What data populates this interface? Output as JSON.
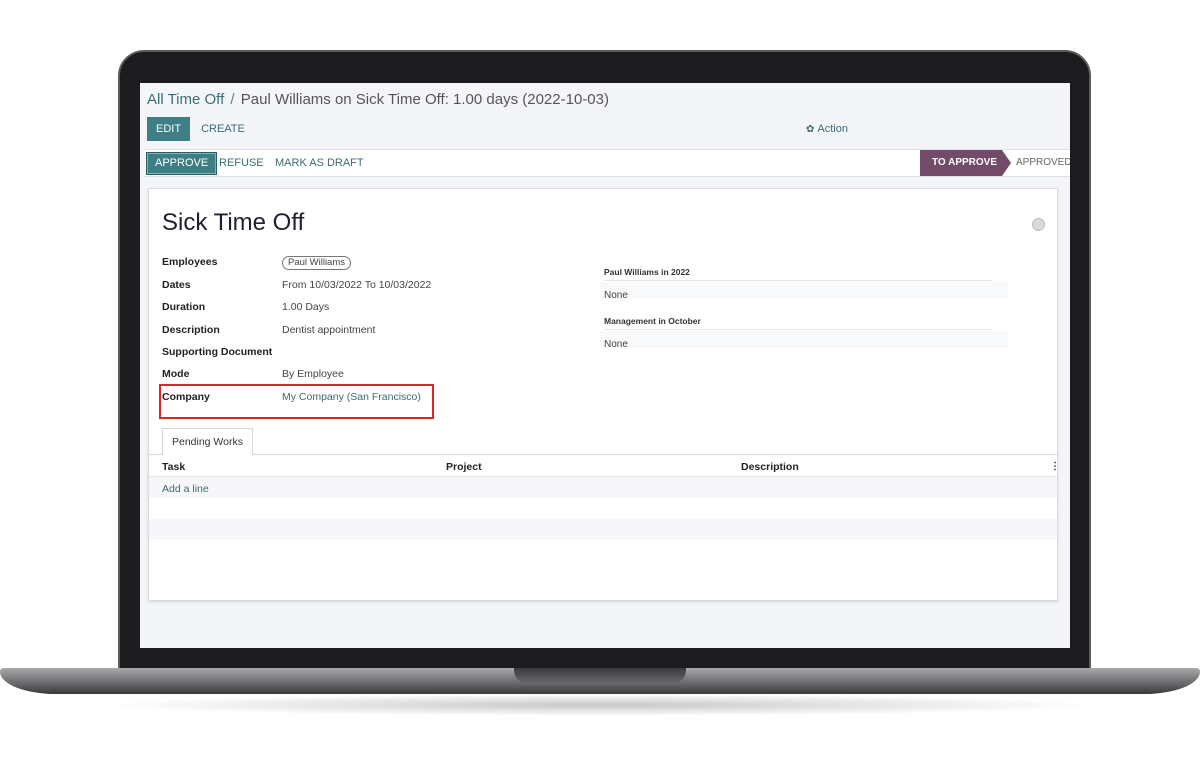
{
  "breadcrumb": {
    "parent": "All Time Off",
    "separator": "/",
    "current": "Paul Williams on Sick Time Off: 1.00 days (2022-10-03)"
  },
  "control_panel": {
    "edit_label": "EDIT",
    "create_label": "CREATE",
    "action_icon": "gear-icon",
    "action_label": "Action"
  },
  "statusbar": {
    "approve_label": "APPROVE",
    "refuse_label": "REFUSE",
    "draft_label": "MARK AS DRAFT",
    "stages": {
      "active": "TO APPROVE",
      "next": "APPROVED"
    },
    "active_stage_color": "#714b67"
  },
  "form": {
    "title": "Sick Time Off",
    "fields": {
      "employees_label": "Employees",
      "employees_value": "Paul Williams",
      "dates_label": "Dates",
      "dates_value": "From 10/03/2022 To 10/03/2022",
      "duration_label": "Duration",
      "duration_value": "1.00 Days",
      "description_label": "Description",
      "description_value": "Dentist appointment",
      "supporting_label": "Supporting Document",
      "mode_label": "Mode",
      "mode_value": "By Employee",
      "company_label": "Company",
      "company_value": "My Company (San Francisco)"
    },
    "summary": {
      "year_title": "Paul Williams in 2022",
      "year_value": "None",
      "month_title": "Management in October",
      "month_value": "None"
    },
    "tabs": {
      "pending_works": "Pending Works"
    },
    "table": {
      "columns": [
        "Task",
        "Project",
        "Description"
      ],
      "menu_icon": "vertical-dots-icon",
      "add_line": "Add a line"
    }
  },
  "colors": {
    "primary": "#3e7f85",
    "link": "#3b6a70",
    "highlight": "#d9262c"
  }
}
